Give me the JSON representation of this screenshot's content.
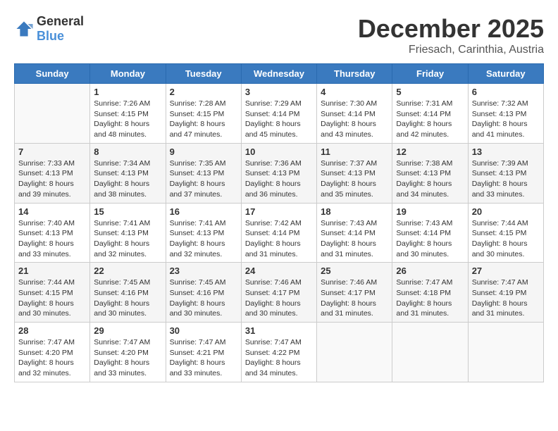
{
  "header": {
    "logo_general": "General",
    "logo_blue": "Blue",
    "month_year": "December 2025",
    "location": "Friesach, Carinthia, Austria"
  },
  "weekdays": [
    "Sunday",
    "Monday",
    "Tuesday",
    "Wednesday",
    "Thursday",
    "Friday",
    "Saturday"
  ],
  "weeks": [
    [
      {
        "day": "",
        "sunrise": "",
        "sunset": "",
        "daylight": ""
      },
      {
        "day": "1",
        "sunrise": "Sunrise: 7:26 AM",
        "sunset": "Sunset: 4:15 PM",
        "daylight": "Daylight: 8 hours and 48 minutes."
      },
      {
        "day": "2",
        "sunrise": "Sunrise: 7:28 AM",
        "sunset": "Sunset: 4:15 PM",
        "daylight": "Daylight: 8 hours and 47 minutes."
      },
      {
        "day": "3",
        "sunrise": "Sunrise: 7:29 AM",
        "sunset": "Sunset: 4:14 PM",
        "daylight": "Daylight: 8 hours and 45 minutes."
      },
      {
        "day": "4",
        "sunrise": "Sunrise: 7:30 AM",
        "sunset": "Sunset: 4:14 PM",
        "daylight": "Daylight: 8 hours and 43 minutes."
      },
      {
        "day": "5",
        "sunrise": "Sunrise: 7:31 AM",
        "sunset": "Sunset: 4:14 PM",
        "daylight": "Daylight: 8 hours and 42 minutes."
      },
      {
        "day": "6",
        "sunrise": "Sunrise: 7:32 AM",
        "sunset": "Sunset: 4:13 PM",
        "daylight": "Daylight: 8 hours and 41 minutes."
      }
    ],
    [
      {
        "day": "7",
        "sunrise": "Sunrise: 7:33 AM",
        "sunset": "Sunset: 4:13 PM",
        "daylight": "Daylight: 8 hours and 39 minutes."
      },
      {
        "day": "8",
        "sunrise": "Sunrise: 7:34 AM",
        "sunset": "Sunset: 4:13 PM",
        "daylight": "Daylight: 8 hours and 38 minutes."
      },
      {
        "day": "9",
        "sunrise": "Sunrise: 7:35 AM",
        "sunset": "Sunset: 4:13 PM",
        "daylight": "Daylight: 8 hours and 37 minutes."
      },
      {
        "day": "10",
        "sunrise": "Sunrise: 7:36 AM",
        "sunset": "Sunset: 4:13 PM",
        "daylight": "Daylight: 8 hours and 36 minutes."
      },
      {
        "day": "11",
        "sunrise": "Sunrise: 7:37 AM",
        "sunset": "Sunset: 4:13 PM",
        "daylight": "Daylight: 8 hours and 35 minutes."
      },
      {
        "day": "12",
        "sunrise": "Sunrise: 7:38 AM",
        "sunset": "Sunset: 4:13 PM",
        "daylight": "Daylight: 8 hours and 34 minutes."
      },
      {
        "day": "13",
        "sunrise": "Sunrise: 7:39 AM",
        "sunset": "Sunset: 4:13 PM",
        "daylight": "Daylight: 8 hours and 33 minutes."
      }
    ],
    [
      {
        "day": "14",
        "sunrise": "Sunrise: 7:40 AM",
        "sunset": "Sunset: 4:13 PM",
        "daylight": "Daylight: 8 hours and 33 minutes."
      },
      {
        "day": "15",
        "sunrise": "Sunrise: 7:41 AM",
        "sunset": "Sunset: 4:13 PM",
        "daylight": "Daylight: 8 hours and 32 minutes."
      },
      {
        "day": "16",
        "sunrise": "Sunrise: 7:41 AM",
        "sunset": "Sunset: 4:13 PM",
        "daylight": "Daylight: 8 hours and 32 minutes."
      },
      {
        "day": "17",
        "sunrise": "Sunrise: 7:42 AM",
        "sunset": "Sunset: 4:14 PM",
        "daylight": "Daylight: 8 hours and 31 minutes."
      },
      {
        "day": "18",
        "sunrise": "Sunrise: 7:43 AM",
        "sunset": "Sunset: 4:14 PM",
        "daylight": "Daylight: 8 hours and 31 minutes."
      },
      {
        "day": "19",
        "sunrise": "Sunrise: 7:43 AM",
        "sunset": "Sunset: 4:14 PM",
        "daylight": "Daylight: 8 hours and 30 minutes."
      },
      {
        "day": "20",
        "sunrise": "Sunrise: 7:44 AM",
        "sunset": "Sunset: 4:15 PM",
        "daylight": "Daylight: 8 hours and 30 minutes."
      }
    ],
    [
      {
        "day": "21",
        "sunrise": "Sunrise: 7:44 AM",
        "sunset": "Sunset: 4:15 PM",
        "daylight": "Daylight: 8 hours and 30 minutes."
      },
      {
        "day": "22",
        "sunrise": "Sunrise: 7:45 AM",
        "sunset": "Sunset: 4:16 PM",
        "daylight": "Daylight: 8 hours and 30 minutes."
      },
      {
        "day": "23",
        "sunrise": "Sunrise: 7:45 AM",
        "sunset": "Sunset: 4:16 PM",
        "daylight": "Daylight: 8 hours and 30 minutes."
      },
      {
        "day": "24",
        "sunrise": "Sunrise: 7:46 AM",
        "sunset": "Sunset: 4:17 PM",
        "daylight": "Daylight: 8 hours and 30 minutes."
      },
      {
        "day": "25",
        "sunrise": "Sunrise: 7:46 AM",
        "sunset": "Sunset: 4:17 PM",
        "daylight": "Daylight: 8 hours and 31 minutes."
      },
      {
        "day": "26",
        "sunrise": "Sunrise: 7:47 AM",
        "sunset": "Sunset: 4:18 PM",
        "daylight": "Daylight: 8 hours and 31 minutes."
      },
      {
        "day": "27",
        "sunrise": "Sunrise: 7:47 AM",
        "sunset": "Sunset: 4:19 PM",
        "daylight": "Daylight: 8 hours and 31 minutes."
      }
    ],
    [
      {
        "day": "28",
        "sunrise": "Sunrise: 7:47 AM",
        "sunset": "Sunset: 4:20 PM",
        "daylight": "Daylight: 8 hours and 32 minutes."
      },
      {
        "day": "29",
        "sunrise": "Sunrise: 7:47 AM",
        "sunset": "Sunset: 4:20 PM",
        "daylight": "Daylight: 8 hours and 33 minutes."
      },
      {
        "day": "30",
        "sunrise": "Sunrise: 7:47 AM",
        "sunset": "Sunset: 4:21 PM",
        "daylight": "Daylight: 8 hours and 33 minutes."
      },
      {
        "day": "31",
        "sunrise": "Sunrise: 7:47 AM",
        "sunset": "Sunset: 4:22 PM",
        "daylight": "Daylight: 8 hours and 34 minutes."
      },
      {
        "day": "",
        "sunrise": "",
        "sunset": "",
        "daylight": ""
      },
      {
        "day": "",
        "sunrise": "",
        "sunset": "",
        "daylight": ""
      },
      {
        "day": "",
        "sunrise": "",
        "sunset": "",
        "daylight": ""
      }
    ]
  ]
}
